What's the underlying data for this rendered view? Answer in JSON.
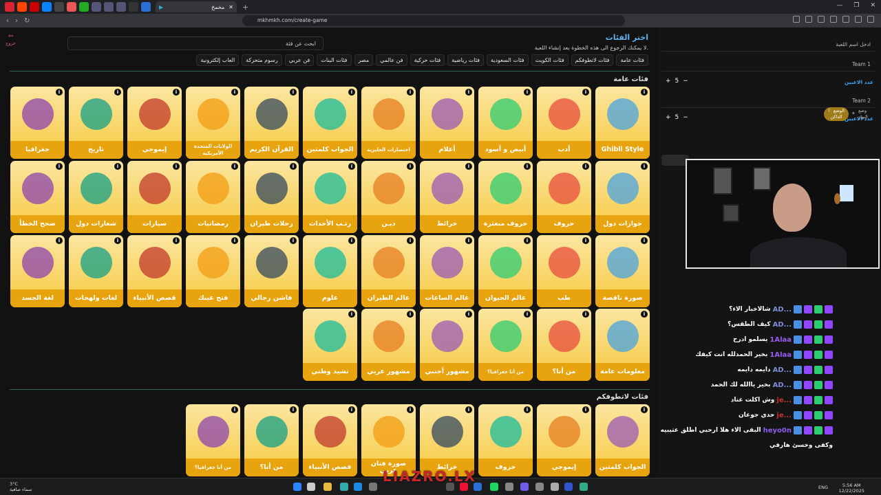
{
  "browser": {
    "tab_title": "مخمخ",
    "url": "mkhmkh.com/create-game",
    "controls": {
      "minimize": "—",
      "restore": "❐",
      "close": "✕"
    }
  },
  "page": {
    "exit_label": "خروج",
    "title": "اختر الفئات",
    "subtitle": "لا يمكنك الرجوع الى هذه الخطوة بعد إنشاء اللعبة.",
    "search_placeholder": "ابحث عن فئة",
    "chips": [
      "فئات عامة",
      "فئات لاتطوفكم",
      "فئات الكويت",
      "فئات السعودية",
      "فئات رياضية",
      "فئات حركية",
      "فن عالمي",
      "مصر",
      "فئات البنات",
      "فن عربي",
      "رسوم متحركة",
      "العاب إلكترونية"
    ],
    "section1_title": "فئات عامة",
    "section2_title": "فئات لاتطوفكم",
    "info_glyph": "i",
    "grid_rows": [
      [
        "Ghibli Style",
        "أدب",
        "أبيض و أسود",
        "أعلام",
        "اختصارات الجليزية",
        "الجواب كلمتين",
        "القرآن الكريم",
        "الولايات المتحدة الأمريكية",
        "إيموجي",
        "تاريخ",
        "جغرافيا"
      ],
      [
        "جوازات دول",
        "حروف",
        "حروف مبعثرة",
        "خرائط",
        "ديـن",
        "رتـب الأحداث",
        "رحلات طيران",
        "رمضانيات",
        "سيارات",
        "شعارات دول",
        "صحح الخطأ"
      ],
      [
        "صورة ناقصة",
        "طب",
        "عالم الحيوان",
        "عالم الساعات",
        "عالم الطيران",
        "علوم",
        "فاشن رجالي",
        "فتح عينك",
        "قصص الأنبياء",
        "لغات ولهجات",
        "لغة الجسد"
      ],
      [
        "معلومات عامة",
        "من أنا؟",
        "من أنا جغرافيا؟",
        "مشهور أجنبي",
        "مشهور عربي",
        "نشيد وطني"
      ]
    ],
    "section2_cards": [
      "الجواب كلمتين",
      "إيموجي",
      "حروف",
      "خرائط",
      "صورة فنان عربي",
      "قصص الأنبياء",
      "من أنا؟",
      "من أنا جغرافيا؟"
    ]
  },
  "sidebar": {
    "game_name_placeholder": "ادخل اسم اللعبة",
    "team1": "Team 1",
    "team2": "Team 2",
    "players_label": "عدد الاعبين",
    "team1_players": "5",
    "team2_players": "5",
    "plus": "+",
    "minus": "−",
    "theme_day": "وضع النهار",
    "theme_night": "الوضع الداكن"
  },
  "chat": [
    {
      "user": "AD...",
      "msg": "شالاخبار الاء؟",
      "color": "#7b8dd6"
    },
    {
      "user": "AD...",
      "msg": "كيف الطقس؟",
      "color": "#7b8dd6"
    },
    {
      "user": "1Alaa",
      "msg": "يسلمو ادرح",
      "color": "#9a5cf0"
    },
    {
      "user": "1Alaa",
      "msg": "بخير الحمدلله انت كيفك",
      "color": "#9a5cf0"
    },
    {
      "user": "AD...",
      "msg": "دايمه دايمه",
      "color": "#7b8dd6"
    },
    {
      "user": "AD...",
      "msg": "بخير ياالله لك الحمد",
      "color": "#7b8dd6"
    },
    {
      "user": "je...",
      "msg": "وش اكلت عناد",
      "color": "#c93030"
    },
    {
      "user": "je...",
      "msg": "حدي جوعان",
      "color": "#c93030"
    },
    {
      "user": "heyo0n",
      "msg": "البقى الاء هلا ارحبي اطلق عتيبيه",
      "color": "#8e5cf0"
    },
    {
      "user": "",
      "msg": "وكفى وخسئ هارفي",
      "color": "#ffffff"
    }
  ],
  "taskbar": {
    "weather_temp": "3°C",
    "weather_desc": "سماء صافية",
    "language": "ENG",
    "time": "5:56 AM",
    "date": "12/22/2025",
    "watermark": "LIAZRO.LX"
  },
  "colors": {
    "accent": "#62b4f0",
    "card_label": "#e7a40e",
    "card_bg": "#f6c93f",
    "divider": "#2e6b4e"
  }
}
